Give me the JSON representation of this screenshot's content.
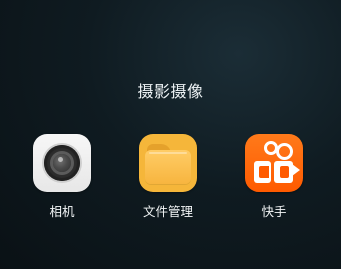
{
  "folder": {
    "title": "摄影摄像"
  },
  "apps": [
    {
      "key": "camera",
      "label": "相机",
      "icon": "camera-icon",
      "accent": "#efefef"
    },
    {
      "key": "files",
      "label": "文件管理",
      "icon": "folder-icon",
      "accent": "#f7b53f"
    },
    {
      "key": "kuaishou",
      "label": "快手",
      "icon": "kuaishou-icon",
      "accent": "#ff6a00"
    }
  ],
  "colors": {
    "background_dark": "#0f1b21",
    "background_accent": "#1b2d36",
    "label_text": "#f3f6f7"
  }
}
